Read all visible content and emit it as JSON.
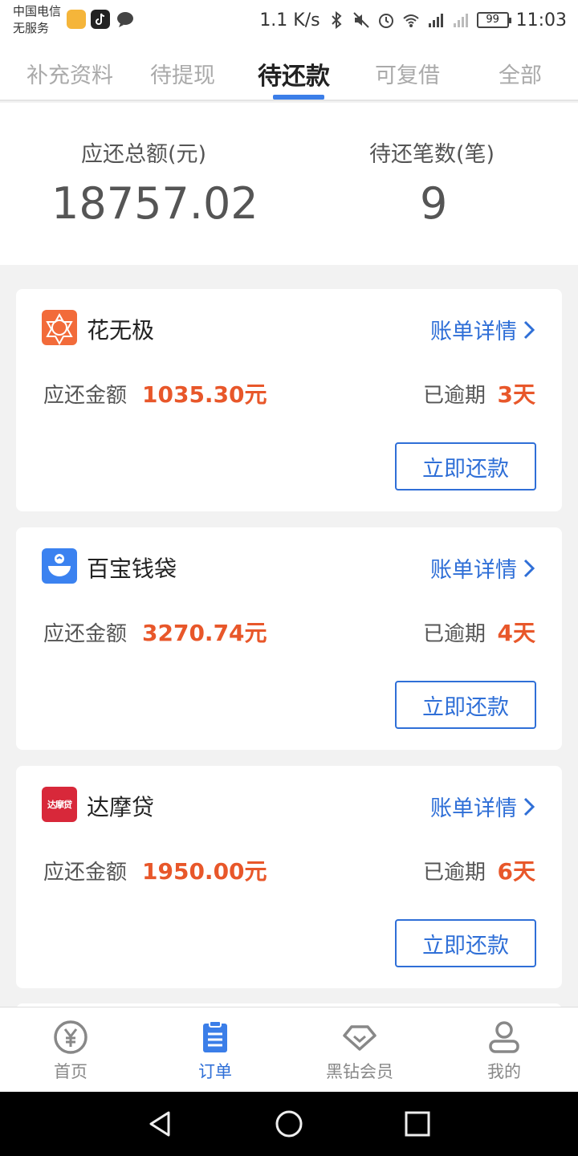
{
  "status_bar": {
    "carrier_line1": "中国电信",
    "carrier_line2": "无服务",
    "net_speed": "1.1 K/s",
    "battery": "99",
    "time": "11:03"
  },
  "tabs": [
    {
      "label": "补充资料",
      "active": false
    },
    {
      "label": "待提现",
      "active": false
    },
    {
      "label": "待还款",
      "active": true
    },
    {
      "label": "可复借",
      "active": false
    },
    {
      "label": "全部",
      "active": false
    }
  ],
  "summary": {
    "total_label": "应还总额(元)",
    "total_value": "18757.02",
    "count_label": "待还笔数(笔)",
    "count_value": "9"
  },
  "loans": [
    {
      "name": "花无极",
      "detail_label": "账单详情",
      "amount_label": "应还金额",
      "amount": "1035.30元",
      "overdue_label": "已逾期",
      "overdue": "3天",
      "pay_label": "立即还款",
      "logo_icon": "flower-icon",
      "logo_color": "#f26b3a"
    },
    {
      "name": "百宝钱袋",
      "detail_label": "账单详情",
      "amount_label": "应还金额",
      "amount": "3270.74元",
      "overdue_label": "已逾期",
      "overdue": "4天",
      "pay_label": "立即还款",
      "logo_icon": "money-bag-icon",
      "logo_color": "#3b82f0"
    },
    {
      "name": "达摩贷",
      "detail_label": "账单详情",
      "amount_label": "应还金额",
      "amount": "1950.00元",
      "overdue_label": "已逾期",
      "overdue": "6天",
      "pay_label": "立即还款",
      "logo_icon": "damodai-logo",
      "logo_color": "#d8283a",
      "logo_text": "达摩贷"
    }
  ],
  "bottom_nav": [
    {
      "label": "首页",
      "icon": "yuan-coin-icon",
      "active": false
    },
    {
      "label": "订单",
      "icon": "clipboard-icon",
      "active": true
    },
    {
      "label": "黑钻会员",
      "icon": "diamond-icon",
      "active": false
    },
    {
      "label": "我的",
      "icon": "person-icon",
      "active": false
    }
  ],
  "colors": {
    "accent_blue": "#2f6fd7",
    "overdue_orange": "#e8572a",
    "tab_underline": "#3b7ee8"
  }
}
